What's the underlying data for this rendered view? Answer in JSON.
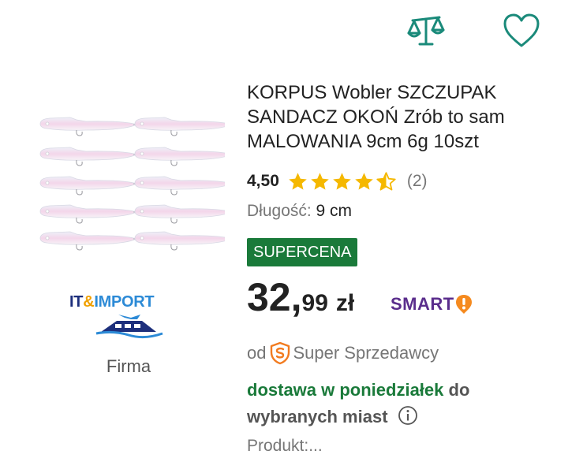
{
  "header": {
    "compare_icon": "scales-compare-icon",
    "favorite_icon": "heart-icon",
    "icon_color": "#1a8a7a"
  },
  "seller": {
    "logo_part1": "IT",
    "logo_part2": "&",
    "logo_part3": "IMPORT",
    "type_label": "Firma"
  },
  "product": {
    "title": "KORPUS Wobler SZCZUPAK SANDACZ OKOŃ Zrób to sam MALOWANIA 9cm 6g 10szt",
    "rating_value": "4,50",
    "rating_stars": 4.5,
    "rating_count": "(2)",
    "attribute_label": "Długość:",
    "attribute_value": "9 cm",
    "badge": "SUPERCENA",
    "price_int": "32,",
    "price_dec": "99",
    "currency": "zł",
    "smart_label": "SMART",
    "seller_prefix": "od",
    "seller_label": "Super Sprzedawcy",
    "delivery_highlight": "dostawa w poniedziałek",
    "delivery_rest_1": "do",
    "delivery_rest_2": "wybranych miast",
    "product_line": "Produkt:..."
  },
  "colors": {
    "accent_green": "#1a7a3a",
    "star": "#f5b800",
    "smart_purple": "#5a2d8c",
    "smart_orange": "#f58a1f",
    "super_orange": "#f27b1f"
  }
}
